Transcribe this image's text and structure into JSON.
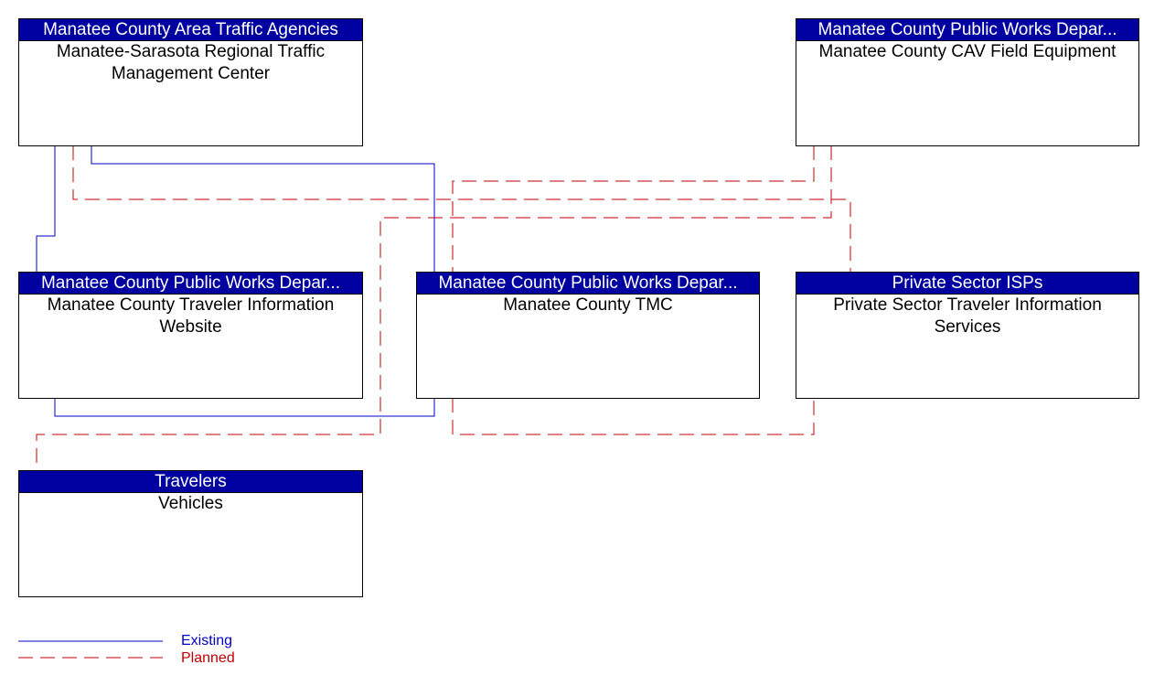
{
  "colors": {
    "existing": "#0000c0",
    "planned": "#c00000",
    "header": "#0000a0"
  },
  "boxes": {
    "rtmc": {
      "owner": "Manatee County Area Traffic Agencies",
      "name": "Manatee-Sarasota Regional Traffic Management Center"
    },
    "cav": {
      "owner": "Manatee County Public Works Depar...",
      "name": "Manatee County CAV Field Equipment"
    },
    "website": {
      "owner": "Manatee County Public Works Depar...",
      "name": "Manatee County Traveler Information Website"
    },
    "tmc": {
      "owner": "Manatee County Public Works Depar...",
      "name": "Manatee County TMC"
    },
    "isp": {
      "owner": "Private Sector ISPs",
      "name": "Private Sector Traveler Information Services"
    },
    "vehicles": {
      "owner": "Travelers",
      "name": "Vehicles"
    }
  },
  "legend": {
    "existing": "Existing",
    "planned": "Planned"
  }
}
